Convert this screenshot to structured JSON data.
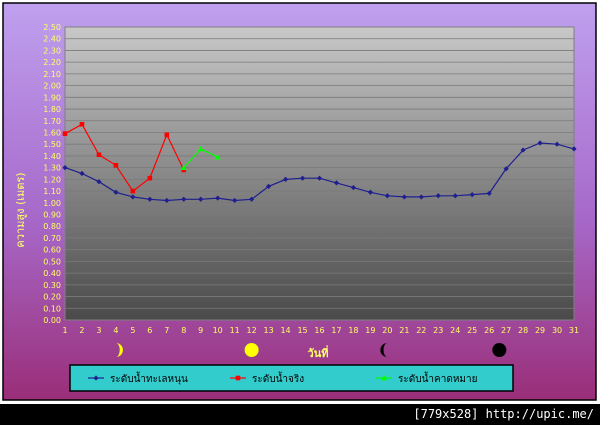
{
  "chart_data": {
    "type": "line",
    "title": "",
    "ylabel": "ความสูง (เมตร)",
    "xlabel": "วันที่",
    "ylim": [
      0,
      2.5
    ],
    "y_ticks": [
      "0.00",
      "0.10",
      "0.20",
      "0.30",
      "0.40",
      "0.50",
      "0.60",
      "0.70",
      "0.80",
      "0.90",
      "1.00",
      "1.10",
      "1.20",
      "1.30",
      "1.40",
      "1.50",
      "1.60",
      "1.70",
      "1.80",
      "1.90",
      "2.00",
      "2.10",
      "2.20",
      "2.30",
      "2.40",
      "2.50"
    ],
    "x": [
      1,
      2,
      3,
      4,
      5,
      6,
      7,
      8,
      9,
      10,
      11,
      12,
      13,
      14,
      15,
      16,
      17,
      18,
      19,
      20,
      21,
      22,
      23,
      24,
      25,
      26,
      27,
      28,
      29,
      30,
      31
    ],
    "grid": true,
    "legend_position": "bottom",
    "series": [
      {
        "name": "ระดับน้ำทะเลหนุน",
        "color": "#1f1f8f",
        "marker": "diamond",
        "x": [
          1,
          2,
          3,
          4,
          5,
          6,
          7,
          8,
          9,
          10,
          11,
          12,
          13,
          14,
          15,
          16,
          17,
          18,
          19,
          20,
          21,
          22,
          23,
          24,
          25,
          26,
          27,
          28,
          29,
          30,
          31
        ],
        "values": [
          1.3,
          1.25,
          1.18,
          1.09,
          1.05,
          1.03,
          1.02,
          1.03,
          1.03,
          1.04,
          1.02,
          1.03,
          1.14,
          1.2,
          1.21,
          1.21,
          1.17,
          1.13,
          1.09,
          1.06,
          1.05,
          1.05,
          1.06,
          1.06,
          1.07,
          1.08,
          1.29,
          1.45,
          1.51,
          1.5,
          1.46
        ]
      },
      {
        "name": "ระดับน้ำจริง",
        "color": "#ff0000",
        "marker": "square",
        "x": [
          1,
          2,
          3,
          4,
          5,
          6,
          7,
          8
        ],
        "values": [
          1.59,
          1.67,
          1.41,
          1.32,
          1.1,
          1.21,
          1.58,
          1.28
        ]
      },
      {
        "name": "ระดับน้ำคาดหมาย",
        "color": "#00ff00",
        "marker": "triangle",
        "x": [
          8,
          9,
          10
        ],
        "values": [
          1.3,
          1.46,
          1.39
        ]
      }
    ],
    "moon_phases": [
      {
        "icon": "first-quarter-moon-icon",
        "x": 4.0
      },
      {
        "icon": "full-moon-icon",
        "x": 12.0
      },
      {
        "icon": "last-quarter-moon-icon",
        "x": 20.0
      },
      {
        "icon": "new-moon-icon",
        "x": 26.6
      }
    ],
    "colors": {
      "background_top": "#bfa0ef",
      "background_bottom": "#9a2e78",
      "plot_top": "#c8c8c8",
      "plot_bottom": "#4a4a4a",
      "axis_text": "#ffff66",
      "legend_bg": "#33cccc"
    }
  },
  "watermark": "[779x528] http://upic.me/"
}
